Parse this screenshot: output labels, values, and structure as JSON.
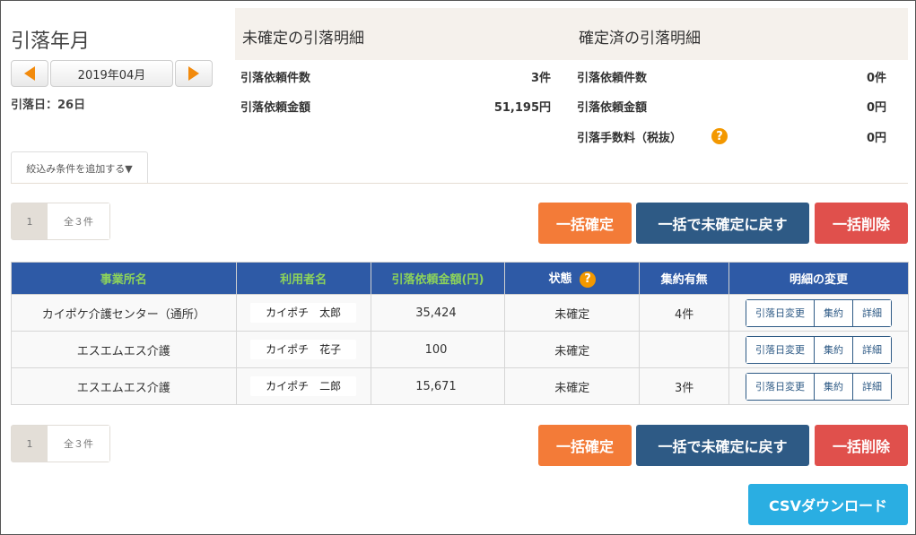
{
  "month": {
    "title": "引落年月",
    "current": "2019年04月",
    "debit_day": "引落日：26日",
    "prev_icon": "arrow-left-icon",
    "next_icon": "arrow-right-icon"
  },
  "summary": {
    "unconfirmed_heading": "未確定の引落明細",
    "confirmed_heading": "確定済の引落明細",
    "unconfirmed": {
      "count_label": "引落依頼件数",
      "count_value": "3件",
      "amount_label": "引落依頼金額",
      "amount_value": "51,195円"
    },
    "confirmed": {
      "count_label": "引落依頼件数",
      "count_value": "0件",
      "amount_label": "引落依頼金額",
      "amount_value": "0円",
      "fee_label": "引落手数料（税抜）",
      "fee_value": "0円"
    },
    "help_mark": "?"
  },
  "filter": {
    "label": "絞込み条件を追加する▼"
  },
  "pager": {
    "page": "1",
    "total": "全３件"
  },
  "actions": {
    "confirm": "一括確定",
    "revert": "一括で未確定に戻す",
    "delete": "一括削除",
    "csv": "CSVダウンロード"
  },
  "table": {
    "headers": {
      "office": "事業所名",
      "user": "利用者名",
      "amount": "引落依頼金額(円)",
      "status": "状態",
      "aggregate": "集約有無",
      "change": "明細の変更"
    },
    "rows": [
      {
        "office": "カイポケ介護センター（通所）",
        "user": "カイポチ　太郎",
        "amount": "35,424",
        "status": "未確定",
        "aggregate": "4件"
      },
      {
        "office": "エスエムエス介護",
        "user": "カイポチ　花子",
        "amount": "100",
        "status": "未確定",
        "aggregate": ""
      },
      {
        "office": "エスエムエス介護",
        "user": "カイポチ　二郎",
        "amount": "15,671",
        "status": "未確定",
        "aggregate": "3件"
      }
    ],
    "row_buttons": {
      "change_date": "引落日変更",
      "aggregate": "集約",
      "detail": "詳細"
    }
  },
  "colors": {
    "accent_orange": "#f37b38",
    "navy": "#2e5a85",
    "red": "#e0504c",
    "csv_blue": "#2aaee2",
    "header_blue": "#2e5aa6"
  }
}
